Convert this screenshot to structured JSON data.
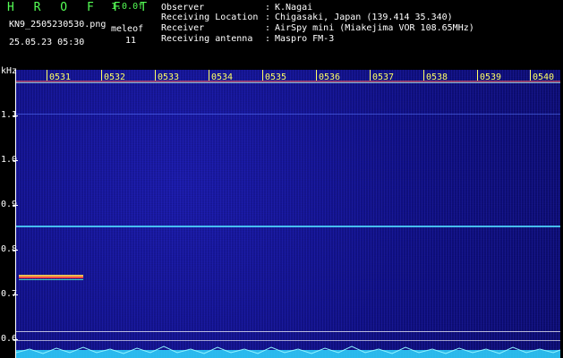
{
  "header": {
    "app_title": "H R O F F T",
    "version": "1.0.0f",
    "filename": "KN9_2505230530.png",
    "datetime": "25.05.23 05:30",
    "meleof_label": "meleof",
    "meleof_value": "11"
  },
  "info": [
    {
      "label": "Observer",
      "value": "K.Nagai"
    },
    {
      "label": "Receiving Location",
      "value": "Chigasaki, Japan (139.414 35.340)"
    },
    {
      "label": "Receiver",
      "value": "AirSpy mini (Miakejima VOR 108.65MHz)"
    },
    {
      "label": "Receiving antenna",
      "value": "Maspro FM-3"
    }
  ],
  "y_axis": {
    "unit": "kHz",
    "labels": [
      "1.1",
      "1.0",
      "0.9",
      "0.8",
      "0.7",
      "0.6"
    ]
  },
  "time_axis": [
    "0531",
    "0532",
    "0533",
    "0534",
    "0535",
    "0536",
    "0537",
    "0538",
    "0539",
    "0540"
  ],
  "colors": {
    "background": "#000000",
    "title_green": "#55ff55",
    "timecode_yellow": "#ffff66",
    "spectrum_blue": "#0d0d7a",
    "signal_line": "#4fd9ff",
    "meteor_trace": "#ff4444"
  }
}
